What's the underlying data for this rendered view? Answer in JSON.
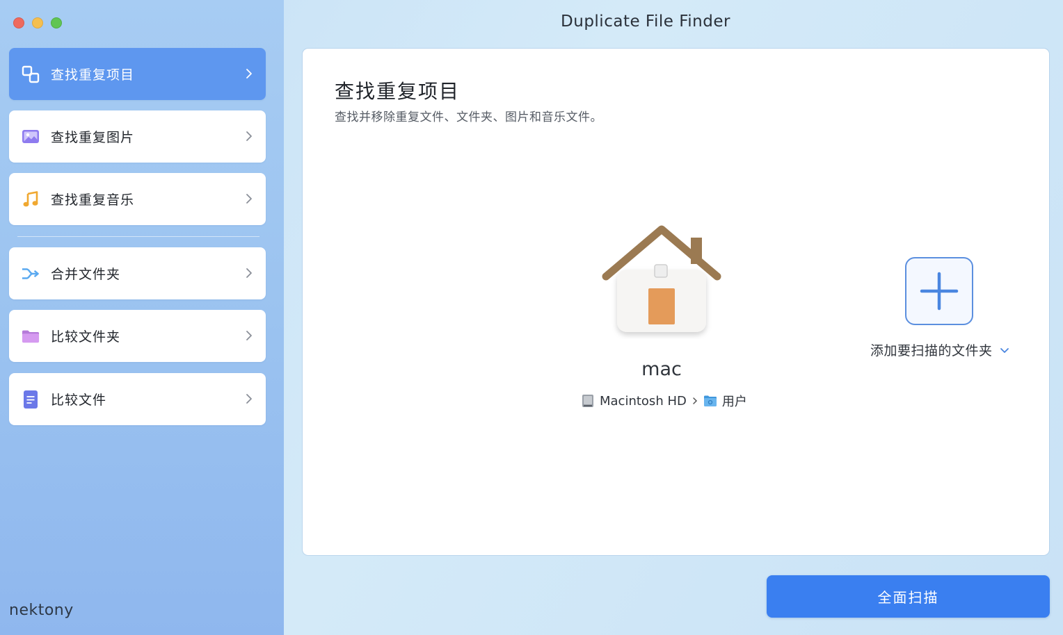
{
  "window": {
    "title": "Duplicate File Finder"
  },
  "sidebar": {
    "items": [
      {
        "label": "查找重复项目",
        "icon": "duplicates-icon",
        "active": true
      },
      {
        "label": "查找重复图片",
        "icon": "image-icon",
        "active": false
      },
      {
        "label": "查找重复音乐",
        "icon": "music-note-icon",
        "active": false
      },
      {
        "label": "合并文件夹",
        "icon": "merge-arrows-icon",
        "active": false
      },
      {
        "label": "比较文件夹",
        "icon": "folder-icon",
        "active": false
      },
      {
        "label": "比较文件",
        "icon": "document-icon",
        "active": false
      }
    ],
    "brand": "nektony"
  },
  "main": {
    "title": "查找重复项目",
    "subtitle": "查找并移除重复文件、文件夹、图片和音乐文件。",
    "location": {
      "name": "mac",
      "path": [
        "Macintosh HD",
        "用户"
      ]
    },
    "add_folder_label": "添加要扫描的文件夹",
    "scan_button": "全面扫描"
  },
  "colors": {
    "accent": "#3a7ff0",
    "active_item": "#5e97ef",
    "music_icon": "#f0a830",
    "folder_icon": "#c98ee8",
    "image_icon": "#8e7bef",
    "merge_icon": "#5aa9f0",
    "doc_icon": "#6b78e8"
  }
}
